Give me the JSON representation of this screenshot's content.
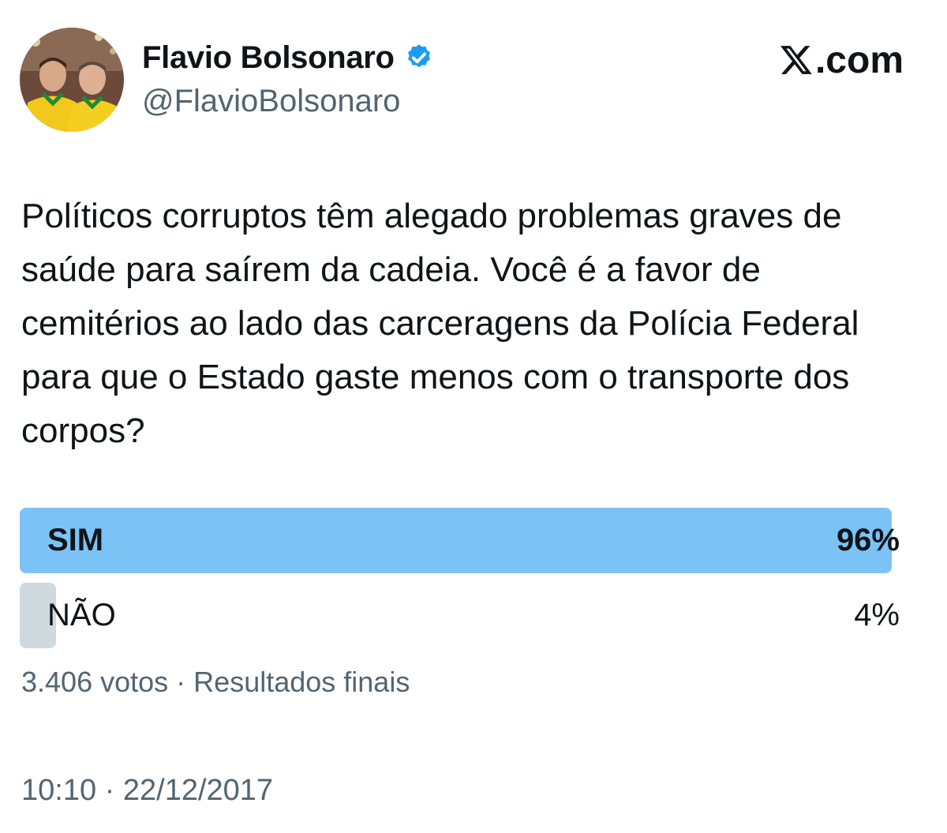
{
  "author": {
    "name": "Flavio Bolsonaro",
    "handle": "@FlavioBolsonaro",
    "verified": true,
    "verified_color": "#1d9bf0"
  },
  "brand": {
    "label": ".com"
  },
  "tweet": {
    "text": "Políticos corruptos têm alegado problemas graves de saúde para saírem da cadeia. Você é a favor de cemitérios ao lado das carceragens da Polícia Federal para que o Estado gaste menos com o transporte dos corpos?"
  },
  "poll": {
    "options": [
      {
        "label": "SIM",
        "percent_text": "96%",
        "percent": 96,
        "winner": true,
        "fill_color": "#7cc3f5"
      },
      {
        "label": "NÃO",
        "percent_text": "4%",
        "percent": 4,
        "winner": false,
        "fill_color": "#cfd9de"
      }
    ],
    "votes": "3.406 votos",
    "separator": "·",
    "status": "Resultados finais"
  },
  "timestamp": {
    "time": "10:10",
    "separator": "·",
    "date": "22/12/2017"
  }
}
